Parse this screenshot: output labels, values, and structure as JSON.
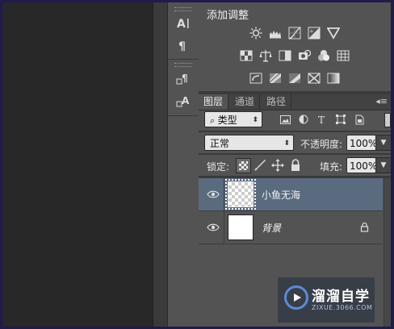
{
  "adjustments": {
    "title": "添加调整",
    "rows": [
      [
        "brightness-contrast-icon",
        "levels-icon",
        "curves-icon",
        "exposure-icon",
        "vibrance-icon"
      ],
      [
        "hue-saturation-icon",
        "color-balance-icon",
        "black-white-icon",
        "photo-filter-icon",
        "channel-mixer-icon",
        "color-lookup-icon"
      ],
      [
        "invert-icon",
        "posterize-icon",
        "threshold-icon",
        "selective-color-icon",
        "gradient-map-icon"
      ]
    ]
  },
  "tools": [
    {
      "name": "character-panel-icon",
      "glyph": "A|"
    },
    {
      "name": "paragraph-panel-icon",
      "glyph": "¶"
    },
    {
      "name": "paragraph-styles-icon",
      "glyph": "¶"
    },
    {
      "name": "character-styles-icon",
      "glyph": "A"
    }
  ],
  "layers_panel": {
    "tabs": [
      "图层",
      "通道",
      "路径"
    ],
    "active_tab": "图层",
    "filter_label": "类型",
    "blend_mode": "正常",
    "opacity_label": "不透明度:",
    "opacity_value": "100%",
    "lock_label": "锁定:",
    "fill_label": "填充:",
    "fill_value": "100%",
    "layers": [
      {
        "name": "小鱼无海",
        "selected": true,
        "thumb": "transparent"
      },
      {
        "name": "背景",
        "selected": false,
        "thumb": "white",
        "locked": true
      }
    ]
  },
  "watermark": {
    "title": "溜溜自学",
    "subtitle": "ZIXUE.3066.COM"
  },
  "colors": {
    "panel_bg": "#535353",
    "selected_layer": "#5a6b80",
    "outer_border": "#1f1b4a"
  }
}
